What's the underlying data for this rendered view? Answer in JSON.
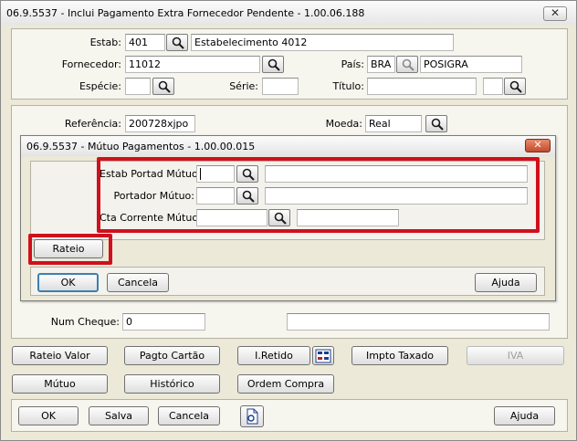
{
  "window": {
    "title": "06.9.5537 - Inclui Pagamento Extra Fornecedor Pendente - 1.00.06.188",
    "close_label": "✕"
  },
  "header": {
    "estab_label": "Estab:",
    "estab_code": "401",
    "estab_name": "Estabelecimento 4012",
    "fornecedor_label": "Fornecedor:",
    "fornecedor_value": "11012",
    "pais_label": "País:",
    "pais_code": "BRA",
    "pais_name": "POSIGRA",
    "especie_label": "Espécie:",
    "especie_value": "",
    "serie_label": "Série:",
    "serie_value": "",
    "titulo_label": "Título:",
    "titulo_value": "",
    "titulo_extra": ""
  },
  "payment": {
    "referencia_label": "Referência:",
    "referencia_value": "200728xjpo",
    "moeda_label": "Moeda:",
    "moeda_value": "Real",
    "num_cheque_label": "Num Cheque:",
    "num_cheque_value": "0",
    "num_cheque_extra": ""
  },
  "dialog": {
    "title": "06.9.5537 - Mútuo Pagamentos - 1.00.00.015",
    "close_label": "✕",
    "estab_portad_label": "Estab Portad Mútuo:",
    "estab_portad_value": "",
    "estab_portad_desc": "",
    "portador_label": "Portador Mútuo:",
    "portador_value": "",
    "portador_desc": "",
    "cta_corrente_label": "Cta Corrente Mútuo:",
    "cta_corrente_value": "",
    "cta_corrente_desc": "",
    "rateio_label": "Rateio",
    "ok_label": "OK",
    "cancel_label": "Cancela",
    "help_label": "Ajuda"
  },
  "actions": {
    "rateio_valor": "Rateio Valor",
    "pagto_cartao": "Pagto Cartão",
    "i_retido": "I.Retido",
    "impto_taxado": "Impto Taxado",
    "iva": "IVA",
    "mutuo": "Mútuo",
    "historico": "Histórico",
    "ordem_compra": "Ordem Compra"
  },
  "footer": {
    "ok_label": "OK",
    "salva_label": "Salva",
    "cancel_label": "Cancela",
    "help_label": "Ajuda"
  },
  "colors": {
    "highlight": "#d0101c",
    "focus_border": "#3c7fb1",
    "background": "#ece9d8"
  }
}
